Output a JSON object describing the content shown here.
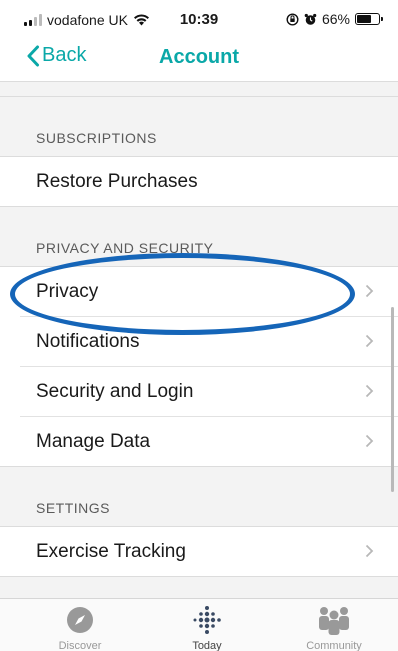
{
  "status_bar": {
    "carrier": "vodafone UK",
    "time": "10:39",
    "battery": "66%",
    "battery_level": 0.66
  },
  "nav": {
    "back_label": "Back",
    "title": "Account"
  },
  "sections": {
    "subscriptions": {
      "header": "SUBSCRIPTIONS",
      "items": [
        {
          "label": "Restore Purchases"
        }
      ]
    },
    "privacy": {
      "header": "PRIVACY AND SECURITY",
      "items": [
        {
          "label": "Privacy"
        },
        {
          "label": "Notifications"
        },
        {
          "label": "Security and Login"
        },
        {
          "label": "Manage Data"
        }
      ]
    },
    "settings": {
      "header": "SETTINGS",
      "items": [
        {
          "label": "Exercise Tracking"
        }
      ]
    }
  },
  "tabs": [
    {
      "label": "Discover",
      "icon": "compass-icon"
    },
    {
      "label": "Today",
      "icon": "fitbit-dots-icon",
      "active": true
    },
    {
      "label": "Community",
      "icon": "people-icon"
    }
  ],
  "colors": {
    "accent": "#0aa8a8",
    "highlight": "#1565b8"
  }
}
